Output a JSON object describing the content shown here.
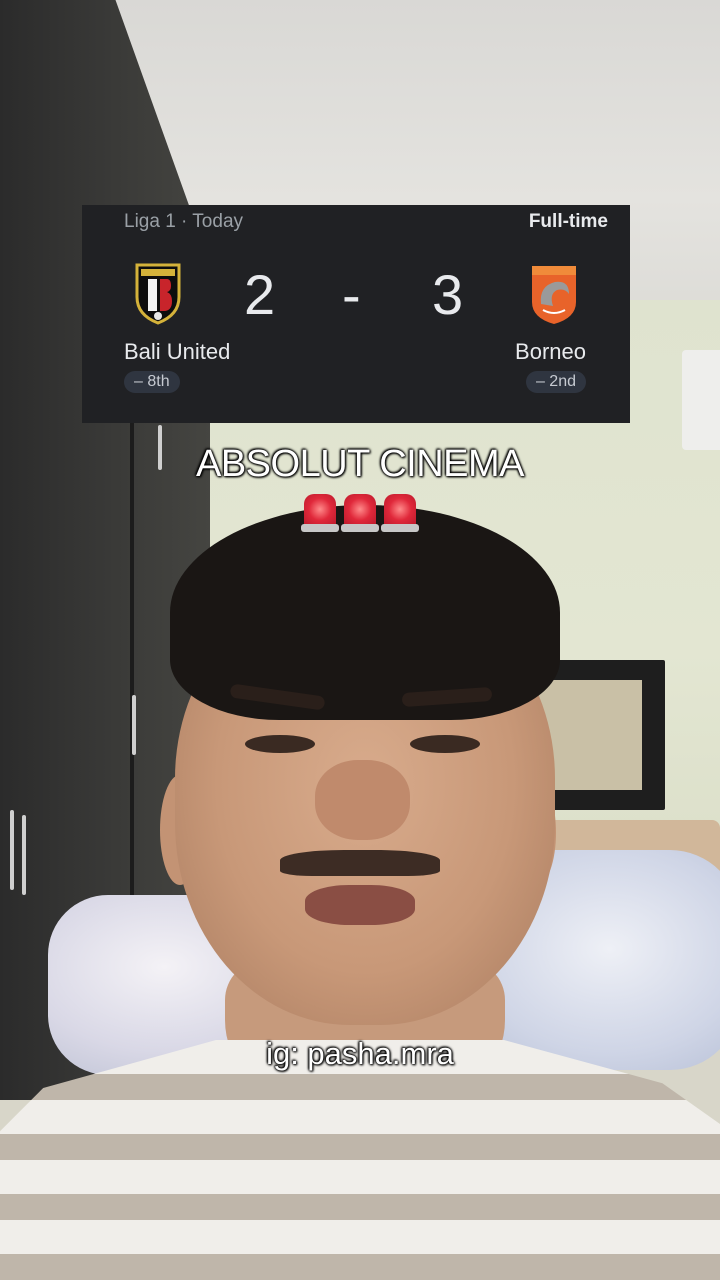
{
  "scorecard": {
    "league": "Liga 1 · Today",
    "status": "Full-time",
    "home": {
      "name": "Bali United",
      "score": "2",
      "rank": "– 8th",
      "logo_icon": "bali-united-crest-icon"
    },
    "separator": "-",
    "away": {
      "name": "Borneo",
      "score": "3",
      "rank": "– 2nd",
      "logo_icon": "borneo-crest-icon"
    }
  },
  "captions": {
    "title": "ABSOLUT CINEMA",
    "emoji_icon": "police-siren-icon",
    "emoji_count": 3,
    "handle": "ig: pasha.mra"
  },
  "colors": {
    "card_background": "#202124",
    "card_text": "#e8eaed",
    "muted_text": "#9aa0a6",
    "caption_text": "#ffffff"
  }
}
